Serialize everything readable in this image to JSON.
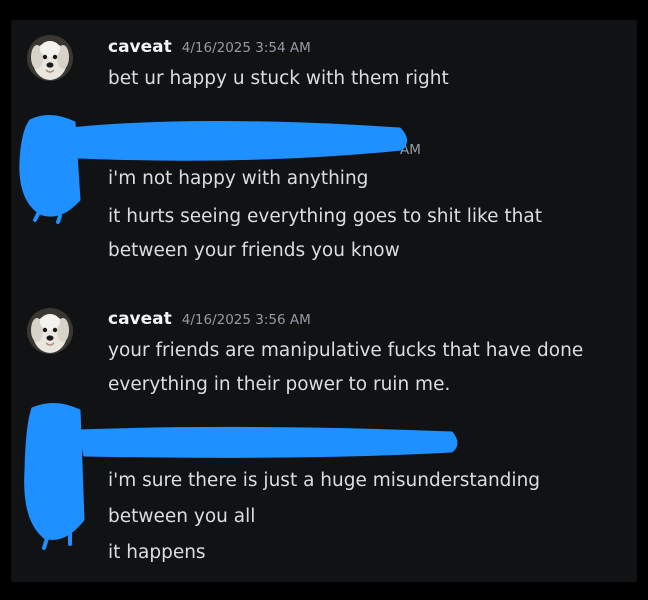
{
  "messages": [
    {
      "username": "caveat",
      "timestamp": "4/16/2025 3:54 AM",
      "lines": [
        "bet ur happy u stuck with them right"
      ],
      "redacted": false
    },
    {
      "username": "",
      "timestamp": "AM",
      "lines": [
        "i'm not happy with anything",
        "it hurts seeing everything goes to shit like that",
        "between your friends you know"
      ],
      "redacted": true
    },
    {
      "username": "caveat",
      "timestamp": "4/16/2025 3:56 AM",
      "lines": [
        "your friends are manipulative fucks that have done",
        "everything in their power to ruin me."
      ],
      "redacted": false
    },
    {
      "username": "",
      "timestamp": "",
      "lines": [
        "i'm sure there is just a huge misunderstanding",
        "between you all",
        "it happens"
      ],
      "redacted": true
    }
  ],
  "colors": {
    "background": "#000000",
    "panel": "#111214",
    "username": "#f2f3f5",
    "timestamp": "#949ba4",
    "message_text": "#dbdee1",
    "redaction": "#1e90ff"
  },
  "icons": {
    "avatar": "dog-avatar-icon",
    "redaction": "redaction-scribble"
  }
}
